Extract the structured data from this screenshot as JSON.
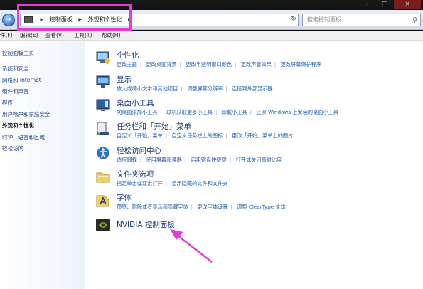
{
  "window": {
    "controls": [
      "–",
      "□",
      "×"
    ]
  },
  "nav": {
    "back_icon": "back-arrow-icon",
    "breadcrumb": [
      "控制面板",
      "外观和个性化"
    ]
  },
  "search": {
    "placeholder": "搜索控制面板"
  },
  "menu": [
    "件(F)",
    "编辑(E)",
    "查看(V)",
    "工具(T)",
    "帮助(H)"
  ],
  "sidebar": {
    "items": [
      "控制面板主页",
      "系统和安全",
      "网络和 Internet",
      "硬件和声音",
      "程序",
      "用户帐户和家庭安全",
      "外观和个性化",
      "时钟、语言和区域",
      "轻松访问"
    ],
    "current_index": 6
  },
  "categories": [
    {
      "title": "个性化",
      "icon": "personalization-icon",
      "links": [
        "更改主题",
        "更改桌面背景",
        "更改半透明窗口颜色",
        "更改声音效果",
        "更改屏幕保护程序"
      ]
    },
    {
      "title": "显示",
      "icon": "display-icon",
      "links": [
        "放大或缩小文本和其他项目",
        "调整屏幕分辨率",
        "连接到外部显示器"
      ]
    },
    {
      "title": "桌面小工具",
      "icon": "desktop-gadgets-icon",
      "links": [
        "向桌面添加小工具",
        "联机获取更多小工具",
        "卸载小工具",
        "还原 Windows 上安装的桌面小工具"
      ]
    },
    {
      "title": "任务栏和「开始」菜单",
      "icon": "taskbar-icon",
      "links": [
        "自定义「开始」菜单",
        "自定义任务栏上的图标",
        "更改「开始」菜单上的图片"
      ]
    },
    {
      "title": "轻松访问中心",
      "icon": "ease-of-access-icon",
      "links": [
        "适应弱视",
        "使用屏幕阅读器",
        "启用键盘快捷键",
        "打开或关闭高对比度"
      ]
    },
    {
      "title": "文件夹选项",
      "icon": "folder-options-icon",
      "links": [
        "指定单击或双击打开",
        "显示隐藏的文件和文件夹"
      ]
    },
    {
      "title": "字体",
      "icon": "fonts-icon",
      "links": [
        "预览、删除或者显示和隐藏字体",
        "更改字体设置",
        "调整 ClearType 文本"
      ]
    },
    {
      "title": "NVIDIA 控制面板",
      "icon": "nvidia-icon",
      "links": []
    }
  ],
  "colors": {
    "highlight": "#e63ad4",
    "link": "#1f5fb0",
    "title": "#1a3a7a"
  }
}
